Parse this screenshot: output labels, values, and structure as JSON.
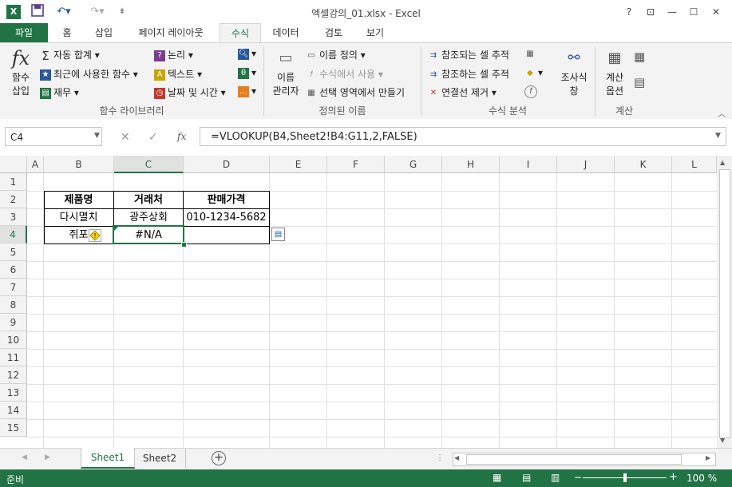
{
  "window": {
    "title": "엑셀강의_01.xlsx - Excel",
    "help": "?"
  },
  "tabs": [
    "파일",
    "홈",
    "삽입",
    "페이지 레이아웃",
    "수식",
    "데이터",
    "검토",
    "보기"
  ],
  "ribbon": {
    "insert_function": {
      "icon": "fx",
      "label1": "함수",
      "label2": "삽입"
    },
    "lib": {
      "autosum": "자동 합계",
      "recent": "최근에 사용한 함수",
      "finance": "재무",
      "logical": "논리",
      "text": "텍스트",
      "datetime": "날짜 및 시간",
      "label": "함수 라이브러리"
    },
    "names": {
      "manager1": "이름",
      "manager2": "관리자",
      "define": "이름 정의",
      "use": "수식에서 사용",
      "create": "선택 영역에서 만들기",
      "label": "정의된 이름"
    },
    "audit": {
      "precedents": "참조되는 셀 추적",
      "dependents": "참조하는 셀 추적",
      "remove": "연결선 제거",
      "watch1": "조사식",
      "watch2": "창",
      "label": "수식 분석"
    },
    "calc": {
      "options1": "계산",
      "options2": "옵션",
      "label": "계산"
    }
  },
  "formula_bar": {
    "name_box": "C4",
    "fx": "fx",
    "formula": "=VLOOKUP(B4,Sheet2!B4:G11,2,FALSE)"
  },
  "columns": [
    "A",
    "B",
    "C",
    "D",
    "E",
    "F",
    "G",
    "H",
    "I",
    "J",
    "K",
    "L"
  ],
  "rows": [
    "1",
    "2",
    "3",
    "4",
    "5",
    "6",
    "7",
    "8",
    "9",
    "10",
    "11",
    "12",
    "13",
    "14",
    "15"
  ],
  "table": {
    "headers": [
      "제품명",
      "거래처",
      "판매가격"
    ],
    "row3": [
      "다시멸치",
      "광주상회",
      "010-1234-5682"
    ],
    "row4": [
      "쥐포",
      "#N/A",
      ""
    ]
  },
  "sheets": {
    "tabs": [
      "Sheet1",
      "Sheet2"
    ],
    "active": "Sheet1"
  },
  "status": {
    "ready": "준비",
    "zoom": "100 %"
  },
  "colors": {
    "accent": "#217346",
    "error_flag": "#f5d400"
  }
}
